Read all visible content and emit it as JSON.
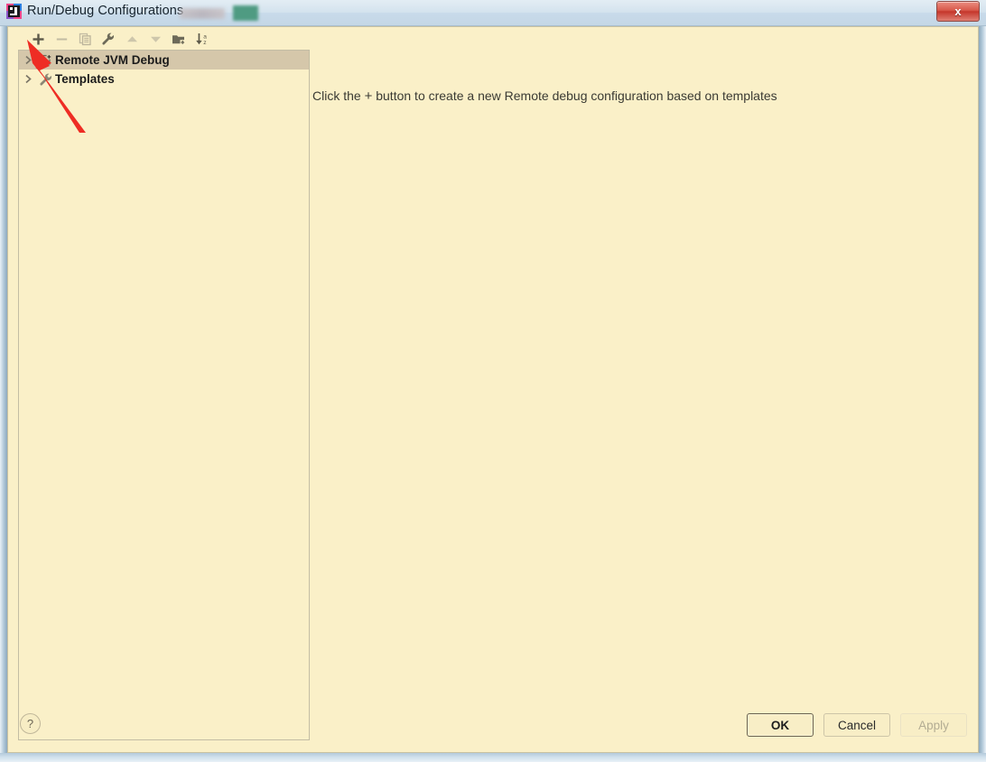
{
  "window": {
    "title": "Run/Debug Configurations",
    "app_icon": "intellij-idea-icon",
    "close_label": "x"
  },
  "toolbar": {
    "buttons": [
      {
        "name": "add-configuration-button",
        "icon": "plus-icon",
        "label": "+",
        "enabled": true
      },
      {
        "name": "remove-configuration-button",
        "icon": "minus-icon",
        "label": "−",
        "enabled": false
      },
      {
        "name": "copy-configuration-button",
        "icon": "copy-icon",
        "label": "Copy",
        "enabled": false
      },
      {
        "name": "edit-templates-button",
        "icon": "wrench-icon",
        "label": "Edit Templates",
        "enabled": true
      },
      {
        "name": "move-up-button",
        "icon": "arrow-up-icon",
        "label": "Move Up",
        "enabled": false
      },
      {
        "name": "move-down-button",
        "icon": "arrow-down-icon",
        "label": "Move Down",
        "enabled": false
      },
      {
        "name": "create-folder-button",
        "icon": "folder-add-icon",
        "label": "Create New Folder",
        "enabled": true
      },
      {
        "name": "sort-configurations-button",
        "icon": "sort-az-icon",
        "label": "Sort Configurations",
        "enabled": true
      }
    ]
  },
  "tree": {
    "items": [
      {
        "label": "Remote JVM Debug",
        "icon": "remote-debug-icon",
        "expand": "chevron-right-icon",
        "selected": true
      },
      {
        "label": "Templates",
        "icon": "wrench-icon",
        "expand": "chevron-right-icon",
        "selected": false
      }
    ]
  },
  "hint": {
    "prefix": "Click the",
    "plus": "+",
    "suffix": "button to create a new Remote debug configuration based on templates"
  },
  "footer": {
    "help_label": "?",
    "ok_label": "OK",
    "cancel_label": "Cancel",
    "apply_label": "Apply"
  },
  "annotation": {
    "arrow": "red-arrow-pointer",
    "points_at": "add-configuration-button"
  },
  "colors": {
    "dialog_background": "#faf0c8",
    "selection": "#d5c7aa",
    "titlebar": "#cfdeea",
    "close_button": "#c5362b",
    "arrow": "#ee2d24"
  }
}
